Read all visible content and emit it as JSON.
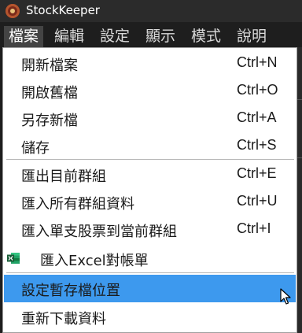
{
  "app": {
    "title": "StockKeeper"
  },
  "menubar": {
    "items": [
      "檔案",
      "編輯",
      "設定",
      "顯示",
      "模式",
      "說明"
    ]
  },
  "file_menu": {
    "items": [
      {
        "label": "開新檔案",
        "shortcut": "Ctrl+N"
      },
      {
        "label": "開啟舊檔",
        "shortcut": "Ctrl+O"
      },
      {
        "label": "另存新檔",
        "shortcut": "Ctrl+A"
      },
      {
        "label": "儲存",
        "shortcut": "Ctrl+S"
      },
      {
        "label": "匯出目前群組",
        "shortcut": "Ctrl+E"
      },
      {
        "label": "匯入所有群組資料",
        "shortcut": "Ctrl+U"
      },
      {
        "label": "匯入單支股票到當前群組",
        "shortcut": "Ctrl+I"
      },
      {
        "label": "匯入Excel對帳單",
        "shortcut": "",
        "icon": "excel-icon"
      },
      {
        "label": "設定暫存檔位置",
        "shortcut": "",
        "highlighted": true
      },
      {
        "label": "重新下載資料",
        "shortcut": ""
      }
    ]
  },
  "colors": {
    "highlight": "#3d99ee",
    "menubar_active": "#444444",
    "excel_green": "#1d6f42"
  }
}
